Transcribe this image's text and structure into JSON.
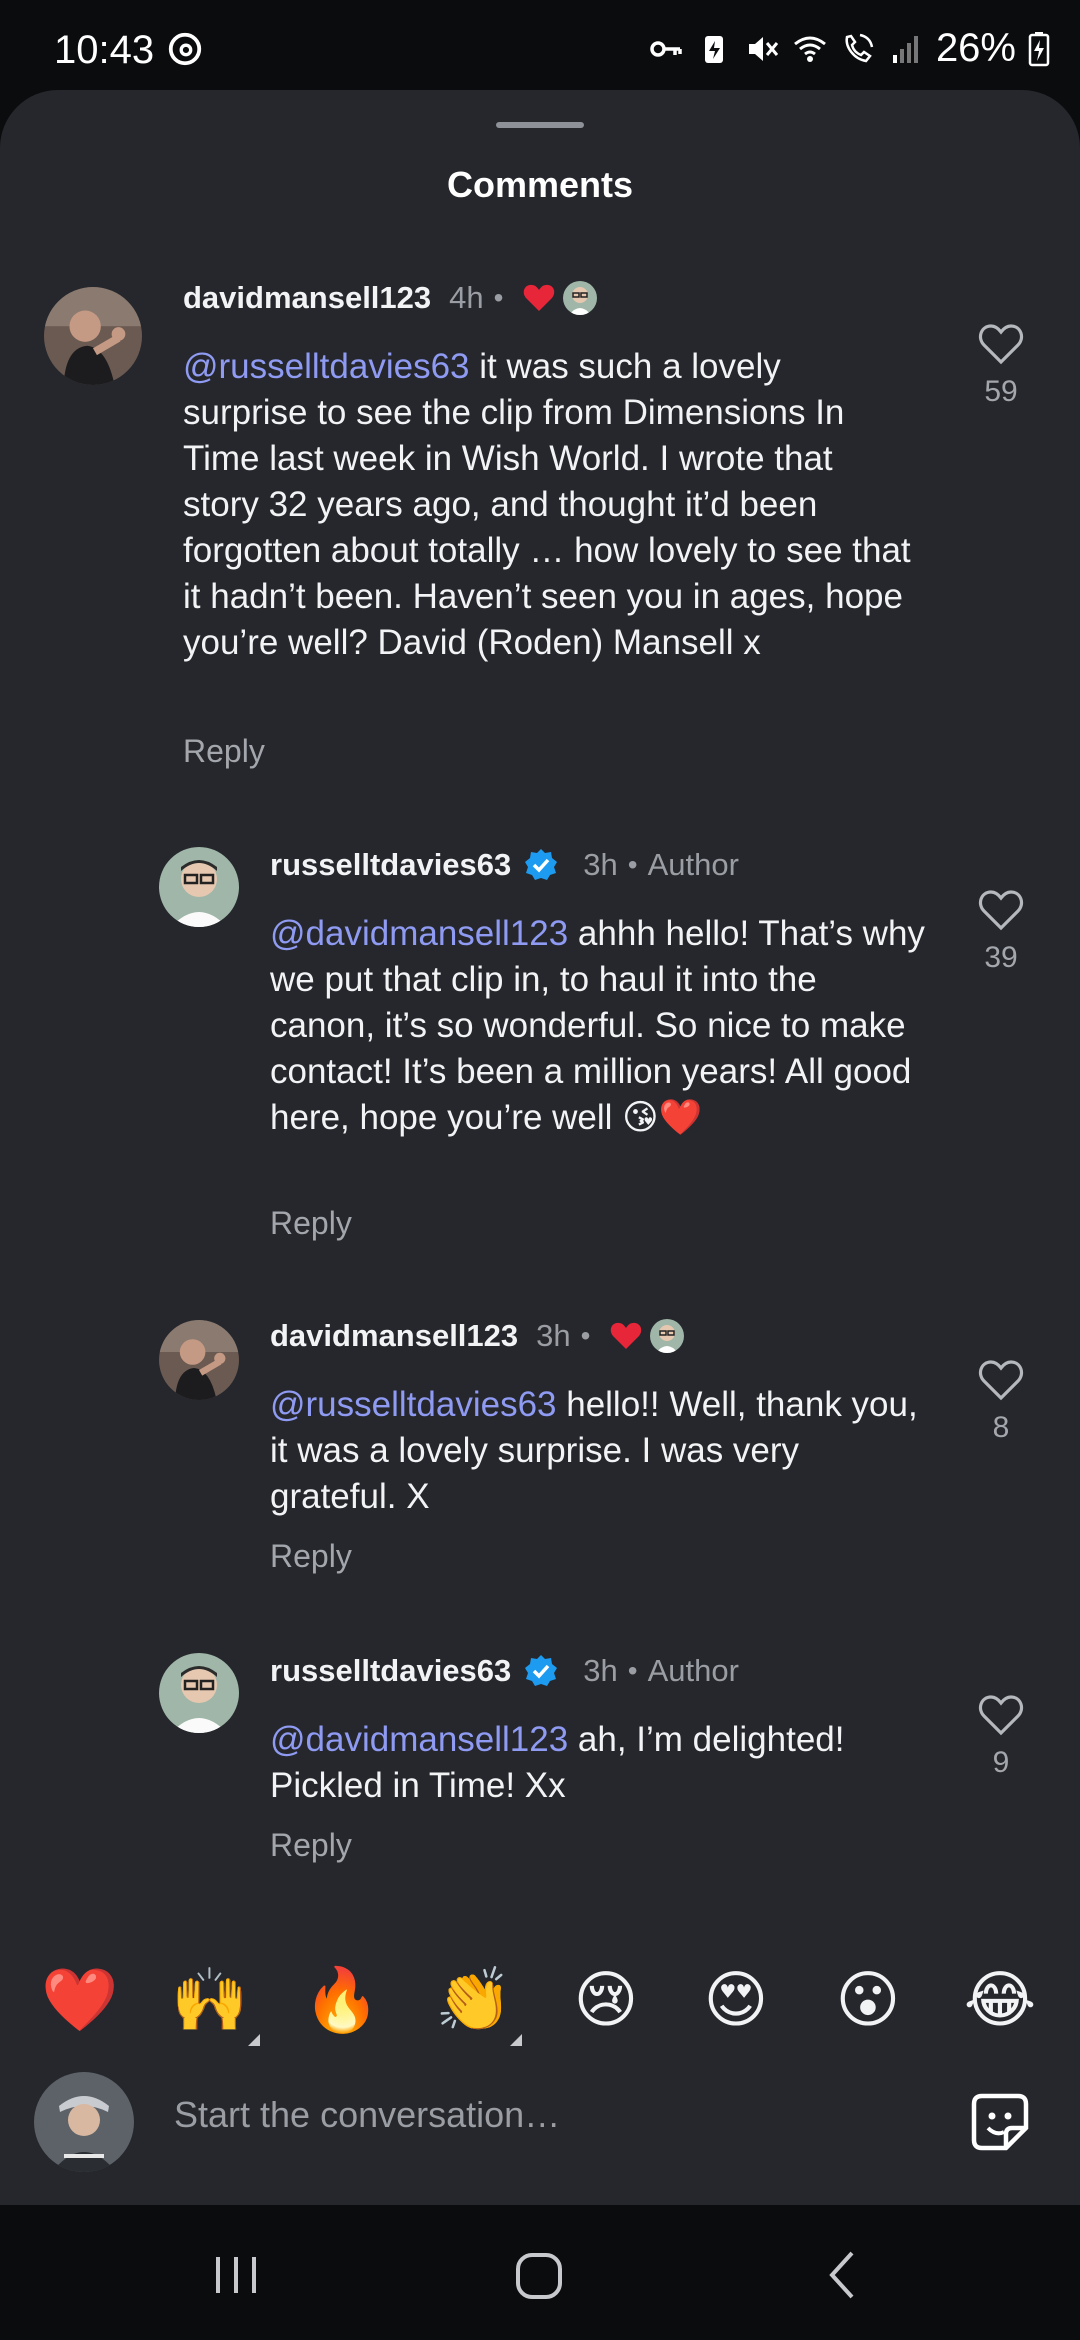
{
  "status_bar": {
    "time": "10:43",
    "battery": "26%"
  },
  "sheet": {
    "title": "Comments"
  },
  "comments": [
    {
      "username": "davidmansell123",
      "time": "4h",
      "mention": "@russelltdavies63",
      "text": " it was such a lovely surprise to see the clip from Dimensions In Time last week in Wish World. I wrote that story 32 years ago, and thought it’d been forgotten about totally … how lovely to see that it hadn’t been. Haven’t seen you in ages, hope you’re well? David (Roden) Mansell x",
      "reply": "Reply",
      "likes": "59"
    },
    {
      "username": "russelltdavies63",
      "time": "3h",
      "author_label": "Author",
      "mention": "@davidmansell123",
      "text": " ahhh hello! That’s why we put that clip in, to haul it into the canon, it’s so wonderful. So nice to make contact! It’s been a million years! All good here, hope you’re well ",
      "emoji": "😘❤️",
      "reply": "Reply",
      "likes": "39"
    },
    {
      "username": "davidmansell123",
      "time": "3h",
      "mention": "@russelltdavies63",
      "text": " hello!! Well, thank you, it was a lovely surprise. I was very grateful. X",
      "reply": "Reply",
      "likes": "8"
    },
    {
      "username": "russelltdavies63",
      "time": "3h",
      "author_label": "Author",
      "mention": "@davidmansell123",
      "text": " ah, I’m delighted! Pickled in Time! Xx",
      "reply": "Reply",
      "likes": "9"
    }
  ],
  "reactions": [
    "❤️",
    "🙌",
    "🔥",
    "👏",
    "😢",
    "😍",
    "😮",
    "😂"
  ],
  "composer": {
    "placeholder": "Start the conversation…"
  },
  "colors": {
    "sheet_bg": "#25272c",
    "mention": "#8f9bf2",
    "verified": "#1d9bf0",
    "heart_red": "#e8263a"
  }
}
